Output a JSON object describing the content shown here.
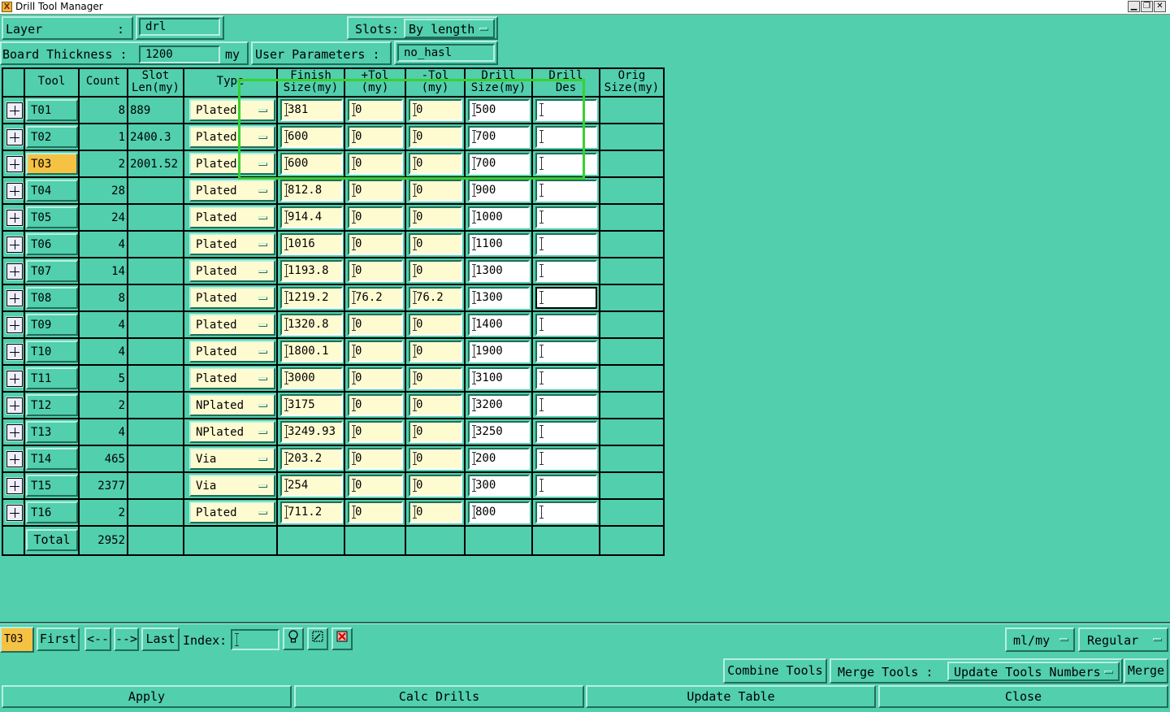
{
  "window": {
    "title": "Drill Tool Manager"
  },
  "header": {
    "layer_label": "Layer",
    "layer_colon": ":",
    "layer_value": "drl",
    "slots_label": "Slots:",
    "slots_value": "By length",
    "board_thickness_label": "Board Thickness :",
    "board_thickness_value": "1200",
    "board_thickness_unit": "my",
    "user_params_label": "User Parameters :",
    "user_params_value": "no_hasl"
  },
  "table": {
    "headers": {
      "tool": "Tool",
      "count": "Count",
      "slot_l1": "Slot",
      "slot_l2": "Len(my)",
      "type": "Type",
      "finish_l1": "Finish",
      "finish_l2": "Size(my)",
      "ptol_l1": "+Tol",
      "ptol_l2": "(my)",
      "mtol_l1": "-Tol",
      "mtol_l2": "(my)",
      "drill_l1": "Drill",
      "drill_l2": "Size(my)",
      "des_l1": "Drill",
      "des_l2": "Des",
      "orig_l1": "Orig",
      "orig_l2": "Size(my)"
    },
    "rows": [
      {
        "tool": "T01",
        "count": "8",
        "slot": "889",
        "type": "Plated",
        "finish": "381",
        "ptol": "0",
        "mtol": "0",
        "drill": "500",
        "des": ""
      },
      {
        "tool": "T02",
        "count": "1",
        "slot": "2400.3",
        "type": "Plated",
        "finish": "600",
        "ptol": "0",
        "mtol": "0",
        "drill": "700",
        "des": ""
      },
      {
        "tool": "T03",
        "count": "2",
        "slot": "2001.52",
        "type": "Plated",
        "finish": "600",
        "ptol": "0",
        "mtol": "0",
        "drill": "700",
        "des": ""
      },
      {
        "tool": "T04",
        "count": "28",
        "slot": "",
        "type": "Plated",
        "finish": "812.8",
        "ptol": "0",
        "mtol": "0",
        "drill": "900",
        "des": ""
      },
      {
        "tool": "T05",
        "count": "24",
        "slot": "",
        "type": "Plated",
        "finish": "914.4",
        "ptol": "0",
        "mtol": "0",
        "drill": "1000",
        "des": ""
      },
      {
        "tool": "T06",
        "count": "4",
        "slot": "",
        "type": "Plated",
        "finish": "1016",
        "ptol": "0",
        "mtol": "0",
        "drill": "1100",
        "des": ""
      },
      {
        "tool": "T07",
        "count": "14",
        "slot": "",
        "type": "Plated",
        "finish": "1193.8",
        "ptol": "0",
        "mtol": "0",
        "drill": "1300",
        "des": ""
      },
      {
        "tool": "T08",
        "count": "8",
        "slot": "",
        "type": "Plated",
        "finish": "1219.2",
        "ptol": "76.2",
        "mtol": "76.2",
        "drill": "1300",
        "des": ""
      },
      {
        "tool": "T09",
        "count": "4",
        "slot": "",
        "type": "Plated",
        "finish": "1320.8",
        "ptol": "0",
        "mtol": "0",
        "drill": "1400",
        "des": ""
      },
      {
        "tool": "T10",
        "count": "4",
        "slot": "",
        "type": "Plated",
        "finish": "1800.1",
        "ptol": "0",
        "mtol": "0",
        "drill": "1900",
        "des": ""
      },
      {
        "tool": "T11",
        "count": "5",
        "slot": "",
        "type": "Plated",
        "finish": "3000",
        "ptol": "0",
        "mtol": "0",
        "drill": "3100",
        "des": ""
      },
      {
        "tool": "T12",
        "count": "2",
        "slot": "",
        "type": "NPlated",
        "finish": "3175",
        "ptol": "0",
        "mtol": "0",
        "drill": "3200",
        "des": ""
      },
      {
        "tool": "T13",
        "count": "4",
        "slot": "",
        "type": "NPlated",
        "finish": "3249.93",
        "ptol": "0",
        "mtol": "0",
        "drill": "3250",
        "des": ""
      },
      {
        "tool": "T14",
        "count": "465",
        "slot": "",
        "type": "Via",
        "finish": "203.2",
        "ptol": "0",
        "mtol": "0",
        "drill": "200",
        "des": ""
      },
      {
        "tool": "T15",
        "count": "2377",
        "slot": "",
        "type": "Via",
        "finish": "254",
        "ptol": "0",
        "mtol": "0",
        "drill": "300",
        "des": ""
      },
      {
        "tool": "T16",
        "count": "2",
        "slot": "",
        "type": "Plated",
        "finish": "711.2",
        "ptol": "0",
        "mtol": "0",
        "drill": "800",
        "des": ""
      }
    ],
    "total_label": "Total",
    "total_count": "2952"
  },
  "navigation": {
    "current_tool": "T03",
    "first": "First",
    "prev": "<--",
    "next": "-->",
    "last": "Last",
    "index_label": "Index:",
    "index_value": "",
    "units_value": "ml/my",
    "mode_value": "Regular"
  },
  "actions": {
    "combine_tools": "Combine Tools",
    "merge_tools_label": "Merge Tools :",
    "merge_option": "Update Tools Numbers",
    "merge": "Merge",
    "apply": "Apply",
    "calc_drills": "Calc Drills",
    "update_table": "Update Table",
    "close": "Close"
  },
  "colors": {
    "background": "#52cfad",
    "input_yellow": "#fffbd1",
    "selected_tool": "#f6c244",
    "highlight_box": "#38d130"
  }
}
